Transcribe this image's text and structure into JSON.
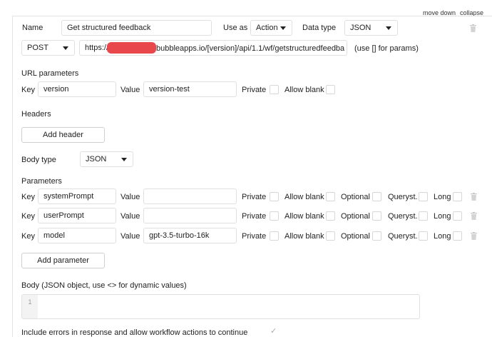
{
  "top_links": {
    "move_down": "move down",
    "collapse": "collapse"
  },
  "call": {
    "name_label": "Name",
    "name_value": "Get structured feedback",
    "use_as_label": "Use as",
    "use_as_value": "Action",
    "data_type_label": "Data type",
    "data_type_value": "JSON",
    "method_value": "POST",
    "url_prefix": "https://",
    "url_suffix": "bubbleapps.io/[version]/api/1.1/wf/getstructuredfeedba",
    "url_hint": "(use [] for params)"
  },
  "url_parameters": {
    "title": "URL parameters",
    "row": {
      "key_label": "Key",
      "key": "version",
      "value_label": "Value",
      "value": "version-test",
      "private_label": "Private",
      "allow_blank_label": "Allow blank"
    }
  },
  "headers": {
    "title": "Headers",
    "add_label": "Add header"
  },
  "body_type": {
    "label": "Body type",
    "value": "JSON"
  },
  "parameters": {
    "title": "Parameters",
    "key_label": "Key",
    "value_label": "Value",
    "private_label": "Private",
    "allow_blank_label": "Allow blank",
    "optional_label": "Optional",
    "queryst_label": "Queryst.",
    "long_label": "Long",
    "rows": [
      {
        "key": "systemPrompt",
        "value": ""
      },
      {
        "key": "userPrompt",
        "value": ""
      },
      {
        "key": "model",
        "value": "gpt-3.5-turbo-16k"
      }
    ],
    "add_label": "Add parameter"
  },
  "body": {
    "label": "Body (JSON object, use <> for dynamic values)",
    "line_number": "1",
    "content": ""
  },
  "include_errors": {
    "label": "Include errors in response and allow workflow actions to continue",
    "checked": true
  },
  "colors": {
    "border": "#e0e0e0",
    "redaction": "#e8474b",
    "text": "#222222"
  },
  "icons": [
    "trash-icon",
    "caret-down-icon",
    "checkmark-icon"
  ]
}
